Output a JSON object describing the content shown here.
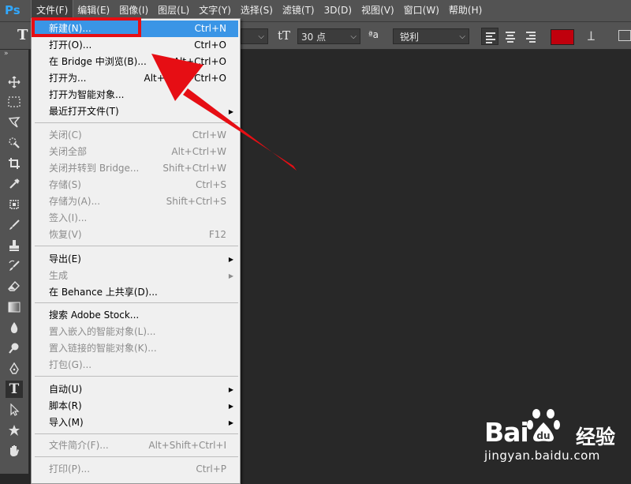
{
  "app": {
    "logo": "Ps"
  },
  "menubar": {
    "items": [
      "文件(F)",
      "编辑(E)",
      "图像(I)",
      "图层(L)",
      "文字(Y)",
      "选择(S)",
      "滤镜(T)",
      "3D(D)",
      "视图(V)",
      "窗口(W)",
      "帮助(H)"
    ],
    "active_index": 0
  },
  "options_bar": {
    "tool_icon": "T",
    "font_size_icon": "tT",
    "font_size": "30 点",
    "aa_icon": "ªa",
    "anti_alias": "锐利",
    "text_color": "#c0000d"
  },
  "file_menu": {
    "items": [
      {
        "label": "新建(N)...",
        "shortcut": "Ctrl+N",
        "state": "highlighted"
      },
      {
        "label": "打开(O)...",
        "shortcut": "Ctrl+O",
        "state": "enabled"
      },
      {
        "label": "在 Bridge 中浏览(B)...",
        "shortcut": "Alt+Ctrl+O",
        "state": "enabled"
      },
      {
        "label": "打开为...",
        "shortcut": "Alt+Shift+Ctrl+O",
        "state": "enabled"
      },
      {
        "label": "打开为智能对象...",
        "shortcut": "",
        "state": "enabled"
      },
      {
        "label": "最近打开文件(T)",
        "shortcut": "",
        "state": "enabled",
        "submenu": true
      },
      {
        "label": "关闭(C)",
        "shortcut": "Ctrl+W",
        "state": "disabled"
      },
      {
        "label": "关闭全部",
        "shortcut": "Alt+Ctrl+W",
        "state": "disabled"
      },
      {
        "label": "关闭并转到 Bridge...",
        "shortcut": "Shift+Ctrl+W",
        "state": "disabled"
      },
      {
        "label": "存储(S)",
        "shortcut": "Ctrl+S",
        "state": "disabled"
      },
      {
        "label": "存储为(A)...",
        "shortcut": "Shift+Ctrl+S",
        "state": "disabled"
      },
      {
        "label": "签入(I)...",
        "shortcut": "",
        "state": "disabled"
      },
      {
        "label": "恢复(V)",
        "shortcut": "F12",
        "state": "disabled"
      },
      {
        "label": "导出(E)",
        "shortcut": "",
        "state": "enabled",
        "submenu": true
      },
      {
        "label": "生成",
        "shortcut": "",
        "state": "disabled",
        "submenu": true
      },
      {
        "label": "在 Behance 上共享(D)...",
        "shortcut": "",
        "state": "enabled"
      },
      {
        "label": "搜索 Adobe Stock...",
        "shortcut": "",
        "state": "enabled"
      },
      {
        "label": "置入嵌入的智能对象(L)...",
        "shortcut": "",
        "state": "disabled"
      },
      {
        "label": "置入链接的智能对象(K)...",
        "shortcut": "",
        "state": "disabled"
      },
      {
        "label": "打包(G)...",
        "shortcut": "",
        "state": "disabled"
      },
      {
        "label": "自动(U)",
        "shortcut": "",
        "state": "enabled",
        "submenu": true
      },
      {
        "label": "脚本(R)",
        "shortcut": "",
        "state": "enabled",
        "submenu": true
      },
      {
        "label": "导入(M)",
        "shortcut": "",
        "state": "enabled",
        "submenu": true
      },
      {
        "label": "文件简介(F)...",
        "shortcut": "Alt+Shift+Ctrl+I",
        "state": "disabled"
      },
      {
        "label": "打印(P)...",
        "shortcut": "Ctrl+P",
        "state": "disabled"
      }
    ]
  },
  "annotation": {
    "color": "#e60e14"
  },
  "watermark": {
    "brand": "Bai",
    "brand_cn": "经验",
    "url": "jingyan.baidu.com"
  }
}
